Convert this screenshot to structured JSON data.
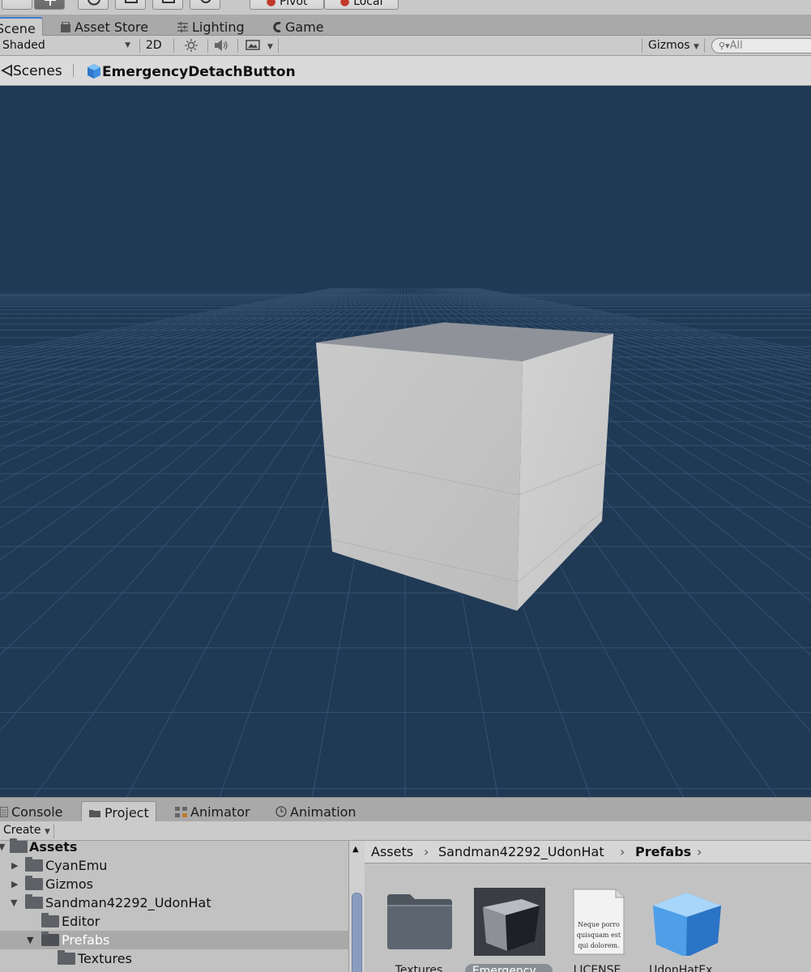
{
  "top_toolbar": {
    "pivot_label": "Pivot",
    "local_label": "Local"
  },
  "scene_tabs": [
    {
      "label": "Scene",
      "icon": "scene-icon"
    },
    {
      "label": "Asset Store",
      "icon": "store-icon"
    },
    {
      "label": "Lighting",
      "icon": "lighting-icon"
    },
    {
      "label": "Game",
      "icon": "game-icon"
    }
  ],
  "scene_toolbar": {
    "shading_mode": "Shaded",
    "mode_2d": "2D",
    "gizmos_label": "Gizmos",
    "search_placeholder": "All"
  },
  "breadcrumb": {
    "scenes_label": "Scenes",
    "object_name": "EmergencyDetachButton"
  },
  "colors": {
    "viewport_bg": "#203a56",
    "accent": "#3d7cd6"
  },
  "bottom_tabs": [
    {
      "label": "Console",
      "icon": "console-icon"
    },
    {
      "label": "Project",
      "icon": "folder-icon"
    },
    {
      "label": "Animator",
      "icon": "animator-icon"
    },
    {
      "label": "Animation",
      "icon": "animation-clock-icon"
    }
  ],
  "project_toolbar": {
    "create_label": "Create"
  },
  "tree": [
    {
      "label": "Assets",
      "expanded": true,
      "bold": true
    },
    {
      "label": "CyanEmu",
      "expanded": false
    },
    {
      "label": "Gizmos",
      "expanded": false
    },
    {
      "label": "Sandman42292_UdonHat",
      "expanded": true
    },
    {
      "label": "Editor"
    },
    {
      "label": "Prefabs",
      "expanded": true,
      "selected": true
    },
    {
      "label": "Textures"
    }
  ],
  "asset_path": [
    "Assets",
    "Sandman42292_UdonHat",
    "Prefabs"
  ],
  "assets": [
    {
      "label": "Textures",
      "kind": "folder"
    },
    {
      "label": "Emergency...",
      "kind": "prefab-dark",
      "selected": true
    },
    {
      "label": "LICENSE",
      "kind": "document",
      "doc_text": "Neque porro quisquam est qui dolorem."
    },
    {
      "label": "UdonHatEx...",
      "kind": "prefab-blue"
    }
  ]
}
